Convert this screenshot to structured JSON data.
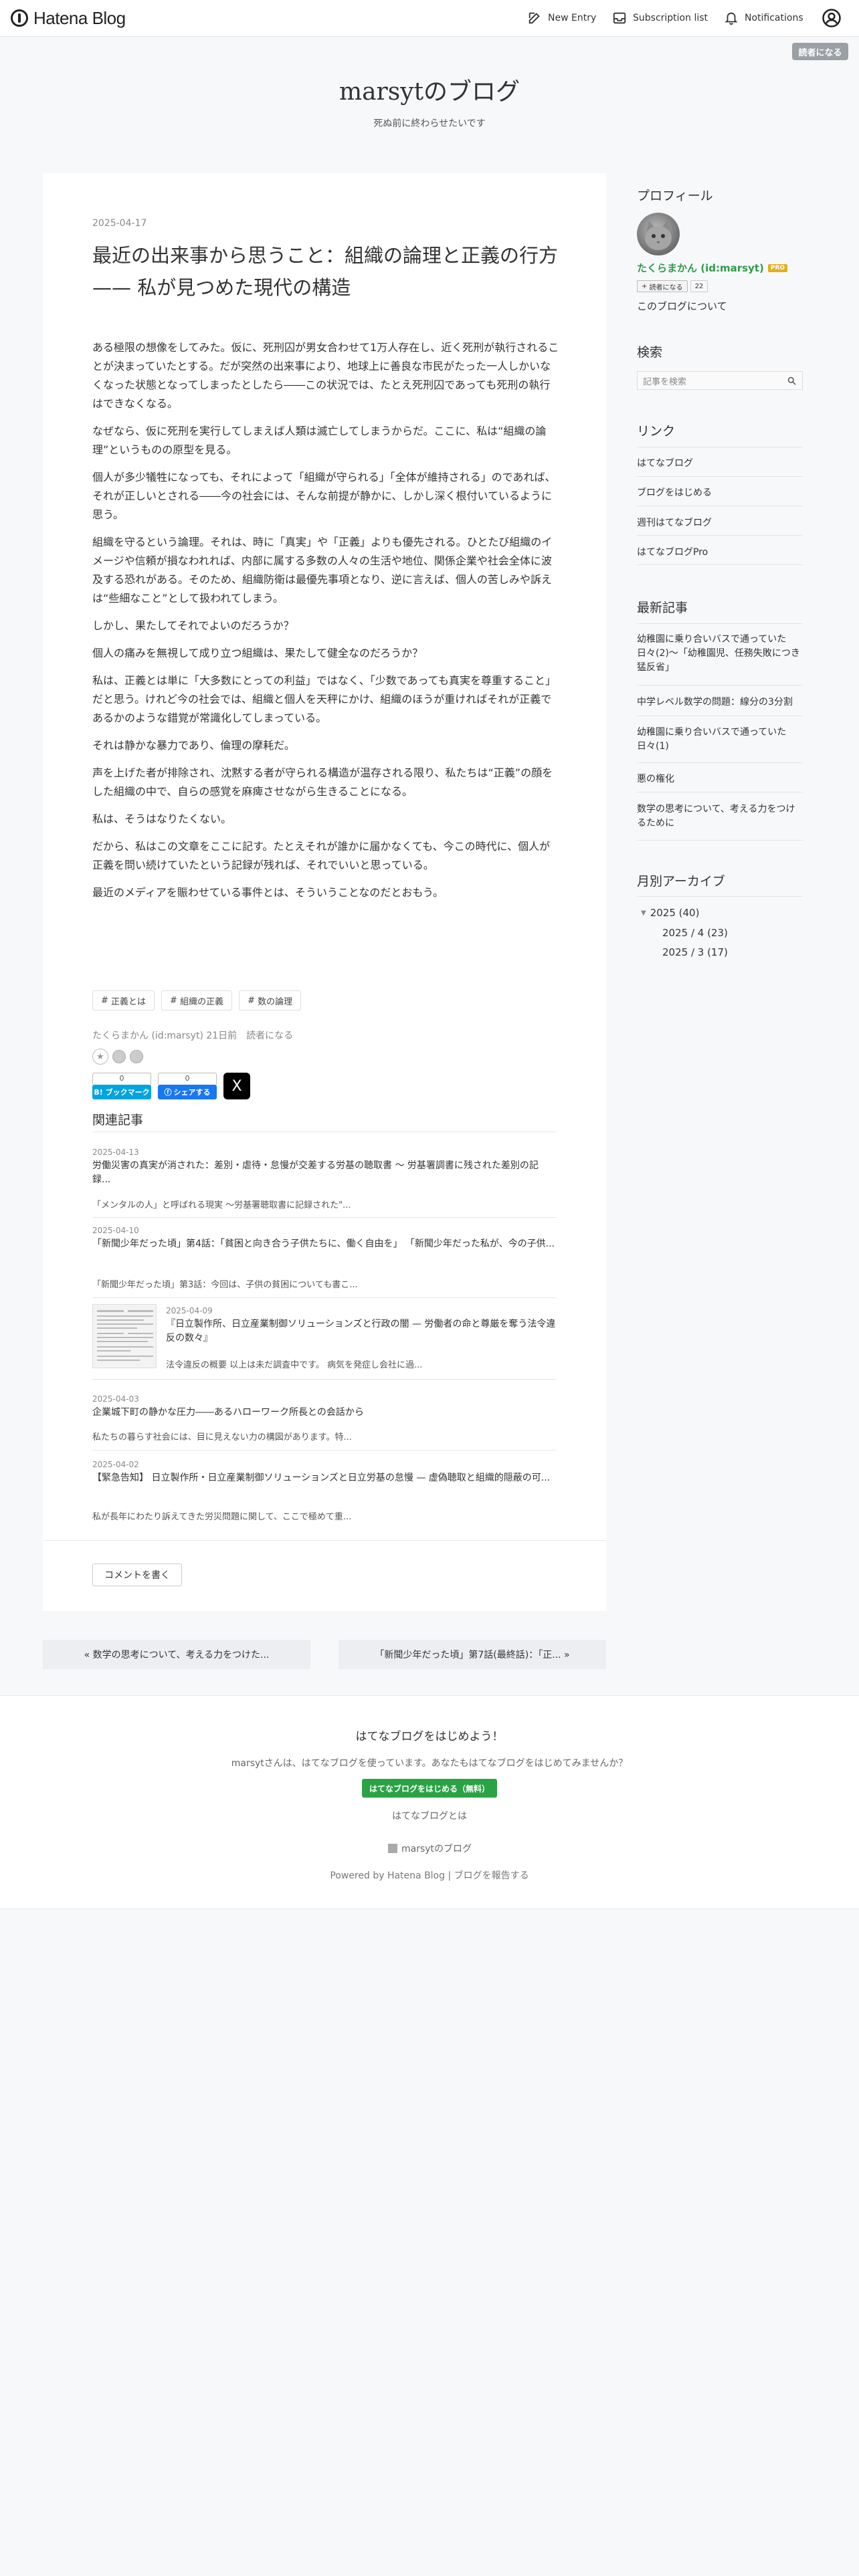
{
  "topbar": {
    "logo_text": "Hatena Blog",
    "new_entry": "New Entry",
    "subscription_list": "Subscription list",
    "notifications": "Notifications"
  },
  "subscribe_button": "読者になる",
  "blog": {
    "title": "marsytのブログ",
    "description": "死ぬ前に終わらせたいです"
  },
  "entry": {
    "date": "2025-04-17",
    "title": "最近の出来事から思うこと：組織の論理と正義の行方 —— 私が見つめた現代の構造",
    "paragraphs": [
      "ある極限の想像をしてみた。仮に、死刑囚が男女合わせて1万人存在し、近く死刑が執行されることが決まっていたとする。だが突然の出来事により、地球上に善良な市民がたった一人しかいなくなった状態となってしまったとしたら――この状況では、たとえ死刑囚であっても死刑の執行はできなくなる。",
      "なぜなら、仮に死刑を実行してしまえば人類は滅亡してしまうからだ。ここに、私は“組織の論理”というものの原型を見る。",
      "個人が多少犠牲になっても、それによって「組織が守られる」「全体が維持される」のであれば、それが正しいとされる――今の社会には、そんな前提が静かに、しかし深く根付いているように思う。",
      "組織を守るという論理。それは、時に「真実」や「正義」よりも優先される。ひとたび組織のイメージや信頼が損なわれれば、内部に属する多数の人々の生活や地位、関係企業や社会全体に波及する恐れがある。そのため、組織防衛は最優先事項となり、逆に言えば、個人の苦しみや訴えは“些細なこと”として扱われてしまう。",
      "しかし、果たしてそれでよいのだろうか？",
      "個人の痛みを無視して成り立つ組織は、果たして健全なのだろうか？",
      "私は、正義とは単に「大多数にとっての利益」ではなく、「少数であっても真実を尊重すること」だと思う。けれど今の社会では、組織と個人を天秤にかけ、組織のほうが重ければそれが正義であるかのような錯覚が常識化してしまっている。",
      "それは静かな暴力であり、倫理の摩耗だ。",
      "声を上げた者が排除され、沈黙する者が守られる構造が温存される限り、私たちは“正義”の顔をした組織の中で、自らの感覚を麻痺させながら生きることになる。",
      "私は、そうはなりたくない。",
      "だから、私はこの文章をここに記す。たとえそれが誰かに届かなくても、今この時代に、個人が正義を問い続けていたという記録が残れば、それでいいと思っている。",
      "最近のメディアを賑わせている事件とは、そういうことなのだとおもう。"
    ],
    "tags": [
      "正義とは",
      "組織の正義",
      "数の論理"
    ],
    "byline": "たくらまかん (id:marsyt) 21日前　読者になる",
    "share": {
      "hatebu_count": "0",
      "hatebu_label": "B! ブックマーク",
      "fb_count": "0",
      "fb_label": "シェアする",
      "x_label": "X"
    }
  },
  "related": {
    "heading": "関連記事",
    "items": [
      {
        "date": "2025-04-13",
        "title": "労働災害の真実が消された：差別・虐待・怠慢が交差する労基の聴取書 〜 労基署調書に残された差別の記録...",
        "snippet": "「メンタルの人」と呼ばれる現実 〜労基署聴取書に記録された\"..."
      },
      {
        "date": "2025-04-10",
        "title": "「新聞少年だった頃」第4話：「貧困と向き合う子供たちに、働く自由を」 「新聞少年だった私が、今の子供...",
        "snippet": "「新聞少年だった頃」第3話：今回は、子供の貧困についても書こ..."
      },
      {
        "date": "2025-04-09",
        "title": "『日立製作所、日立産業制御ソリューションズと行政の闇 — 労働者の命と尊厳を奪う法令違反の数々』",
        "snippet": "法令違反の概要 以上は未だ調査中です。 病気を発症し会社に過..."
      },
      {
        "date": "2025-04-03",
        "title": "企業城下町の静かな圧力――あるハローワーク所長との会話から",
        "snippet": "私たちの暮らす社会には、目に見えない力の構図があります。特..."
      },
      {
        "date": "2025-04-02",
        "title": "【緊急告知】 日立製作所・日立産業制御ソリューションズと日立労基の怠慢 — 虚偽聴取と組織的隠蔽の可...",
        "snippet": "私が長年にわたり訴えてきた労災問題に関して、ここで極めて重..."
      }
    ]
  },
  "comment_button": "コメントを書く",
  "pager": {
    "prev": "« 数学の思考について、考える力をつけた...",
    "next": "「新聞少年だった頃」第7話(最終話)：「正... »"
  },
  "sidebar": {
    "profile": {
      "heading": "プロフィール",
      "name": "たくらまかん (id:marsyt)",
      "pro_badge": "PRO",
      "follow_label": "読者になる",
      "follow_count": "22",
      "about_link": "このブログについて"
    },
    "search": {
      "heading": "検索",
      "placeholder": "記事を検索"
    },
    "links": {
      "heading": "リンク",
      "items": [
        "はてなブログ",
        "ブログをはじめる",
        "週刊はてなブログ",
        "はてなブログPro"
      ]
    },
    "recent": {
      "heading": "最新記事",
      "items": [
        "幼稚園に乗り合いバスで通っていた日々(2)〜「幼稚園児、任務失敗につき猛反省」",
        "中学レベル数学の問題：線分の3分割",
        "幼稚園に乗り合いバスで通っていた日々(1)",
        "悪の権化",
        "数学の思考について、考える力をつけるために"
      ]
    },
    "archive": {
      "heading": "月別アーカイブ",
      "year": "2025 (40)",
      "months": [
        "2025 / 4 (23)",
        "2025 / 3 (17)"
      ]
    }
  },
  "footer": {
    "heading": "はてなブログをはじめよう！",
    "message": "marsytさんは、はてなブログを使っています。あなたもはてなブログをはじめてみませんか？",
    "cta": "はてなブログをはじめる（無料）",
    "about": "はてなブログとは",
    "blog_link": "marsytのブログ",
    "powered": "Powered by Hatena Blog | ブログを報告する"
  }
}
